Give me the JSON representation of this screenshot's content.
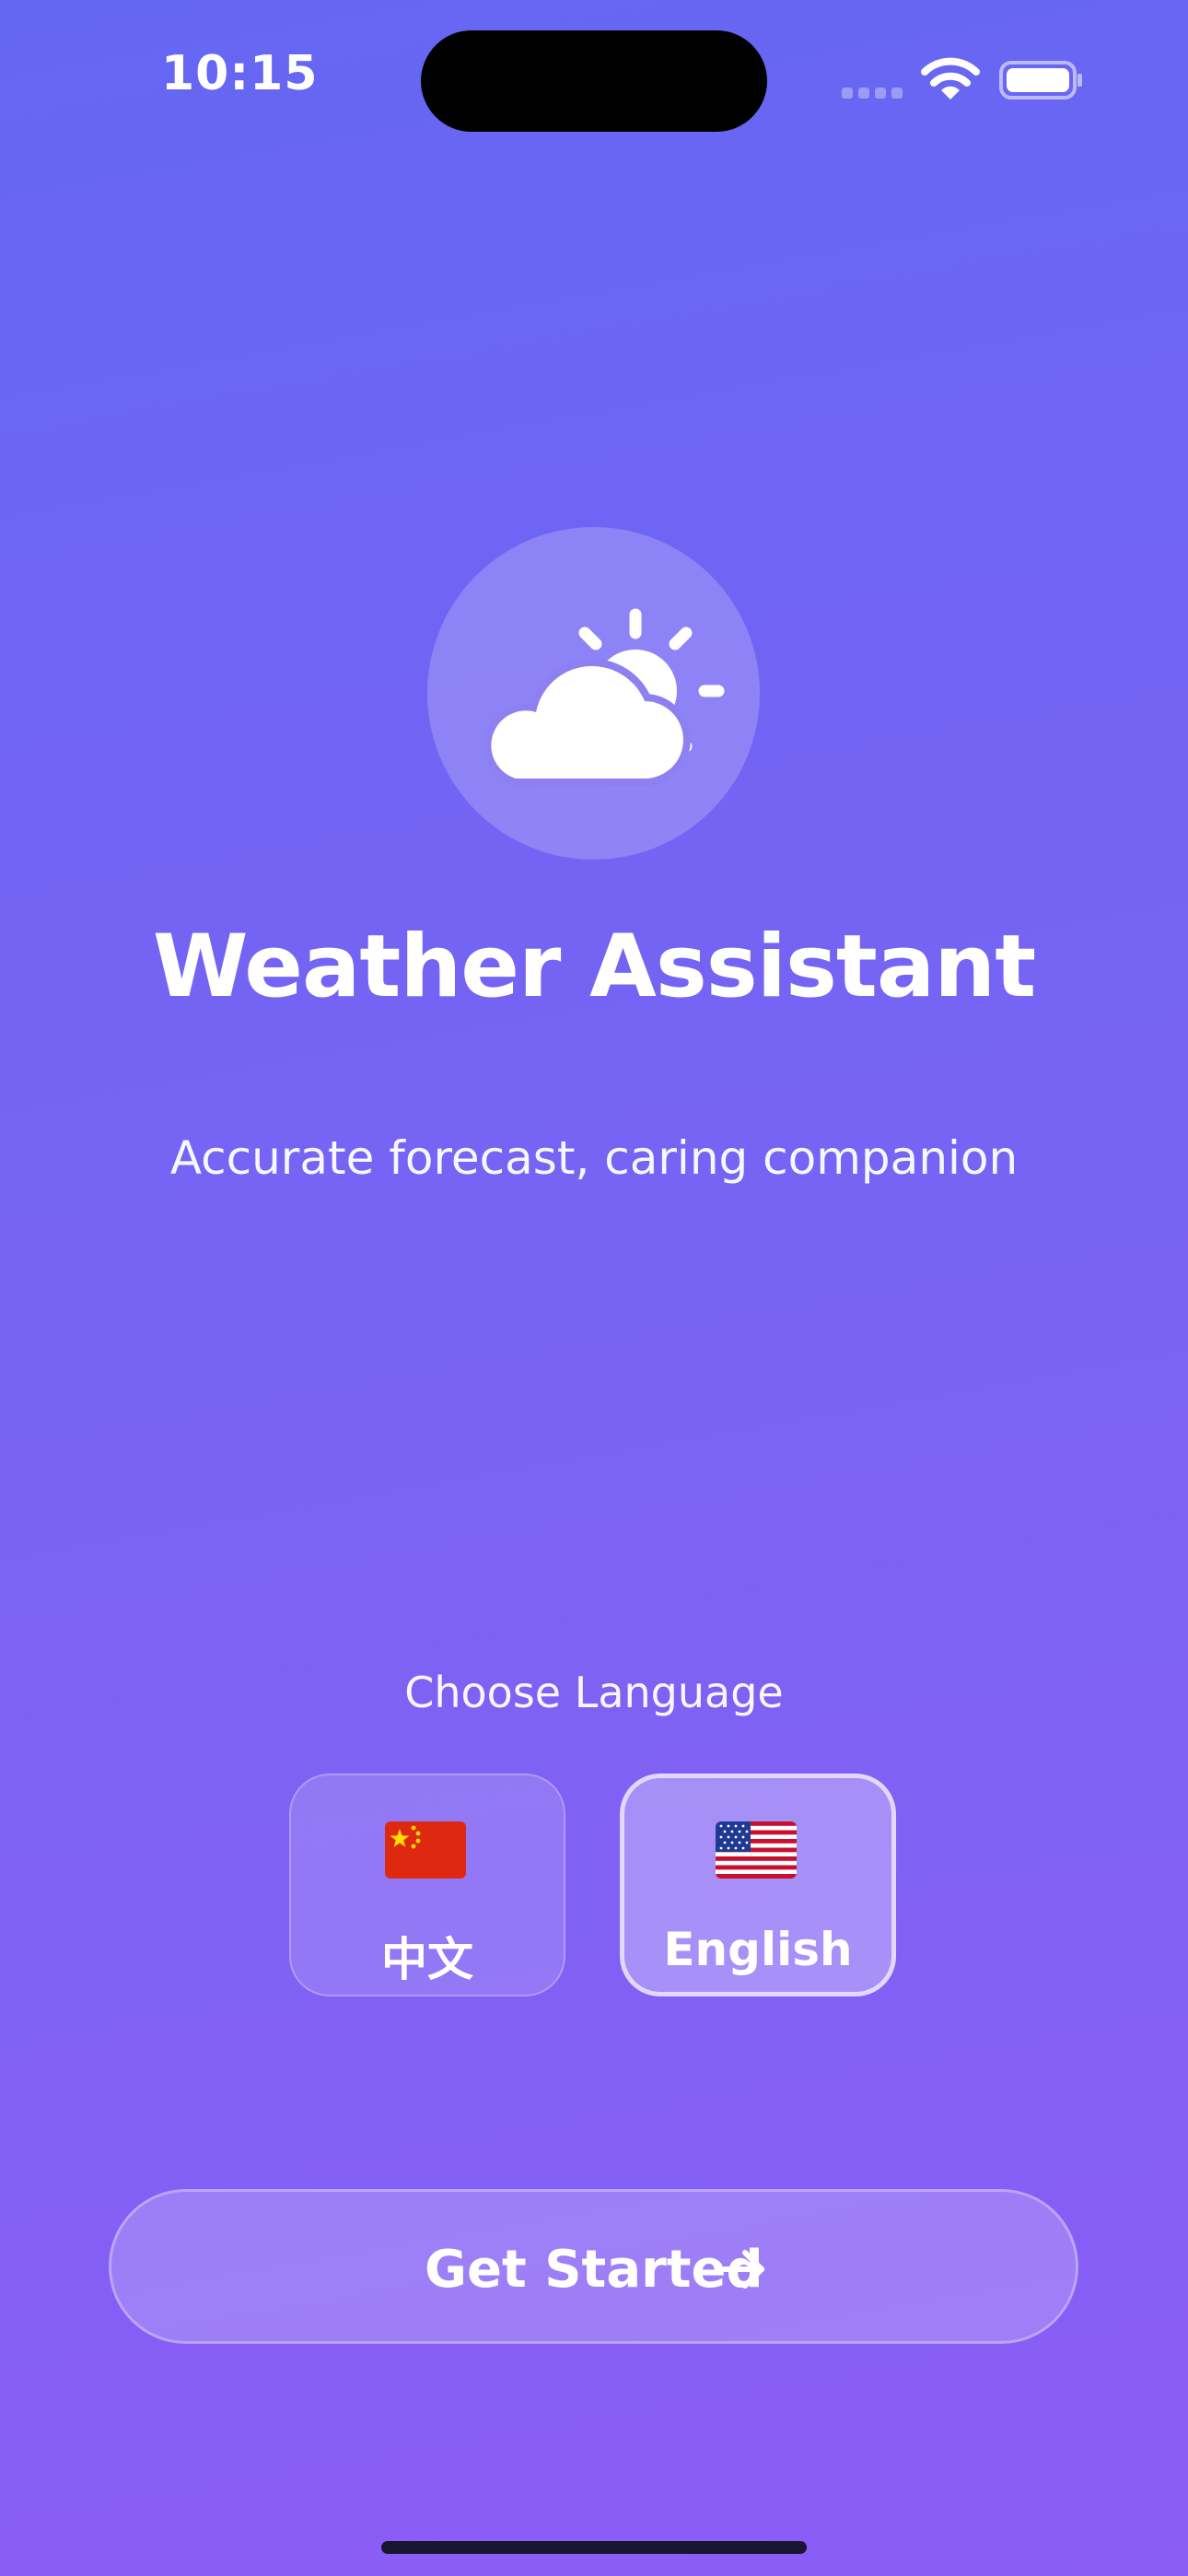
{
  "status_bar": {
    "time": "10:15"
  },
  "hero": {
    "icon": "partly-cloudy-icon",
    "title": "Weather Assistant",
    "subtitle": "Accurate forecast, caring companion"
  },
  "language": {
    "label": "Choose Language",
    "options": [
      {
        "label": "中文",
        "flag": "china-flag-icon",
        "selected": false
      },
      {
        "label": "English",
        "flag": "us-flag-icon",
        "selected": true
      }
    ]
  },
  "cta": {
    "label": "Get Started",
    "icon": "arrow-right-icon"
  },
  "colors": {
    "background_top": "#6467F2",
    "background_bottom": "#8B5CF6"
  }
}
